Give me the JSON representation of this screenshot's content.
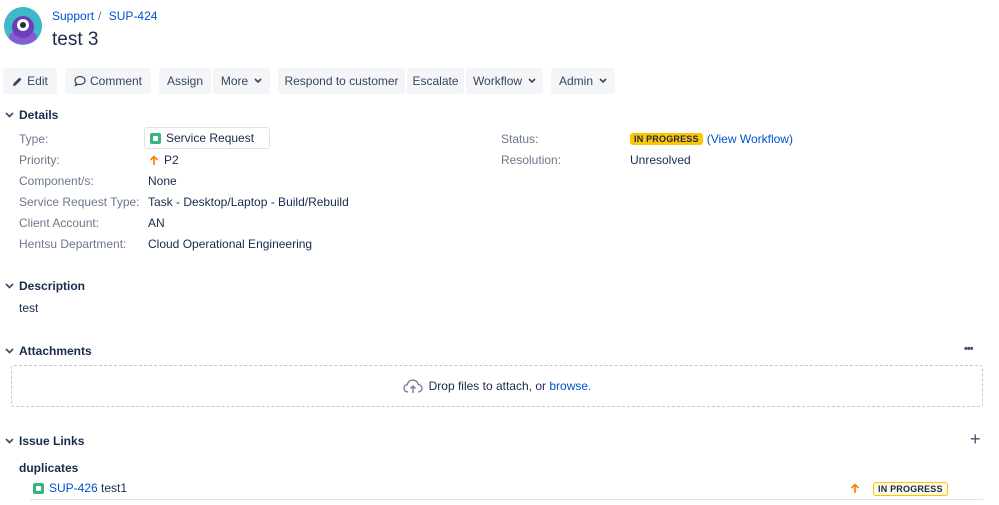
{
  "breadcrumb": {
    "project": "Support",
    "separator": "/",
    "issue_key": "SUP-424"
  },
  "issue": {
    "title": "test 3"
  },
  "toolbar": {
    "edit": "Edit",
    "comment": "Comment",
    "assign": "Assign",
    "more": "More",
    "respond": "Respond to customer",
    "escalate": "Escalate",
    "workflow": "Workflow",
    "admin": "Admin"
  },
  "details": {
    "heading": "Details",
    "type_label": "Type:",
    "type_value": "Service Request",
    "priority_label": "Priority:",
    "priority_value": "P2",
    "components_label": "Component/s:",
    "components_value": "None",
    "srt_label": "Service Request Type:",
    "srt_value": "Task - Desktop/Laptop - Build/Rebuild",
    "client_label": "Client Account:",
    "client_value": "AN",
    "dept_label": "Hentsu Department:",
    "dept_value": "Cloud Operational Engineering",
    "status_label": "Status:",
    "status_value": "IN PROGRESS",
    "view_workflow": "(View Workflow)",
    "resolution_label": "Resolution:",
    "resolution_value": "Unresolved"
  },
  "description": {
    "heading": "Description",
    "text": "test"
  },
  "attachments": {
    "heading": "Attachments",
    "menu": "•••",
    "drop_text": "Drop files to attach, or",
    "browse": "browse."
  },
  "issue_links": {
    "heading": "Issue Links",
    "add": "+",
    "relation": "duplicates",
    "links": [
      {
        "key": "SUP-426",
        "summary": "test1",
        "status": "IN PROGRESS"
      }
    ]
  },
  "colors": {
    "link": "#0052cc",
    "status_yellow": "#ffc400",
    "priority_orange": "#ff7a00",
    "service_green": "#36b37e"
  }
}
